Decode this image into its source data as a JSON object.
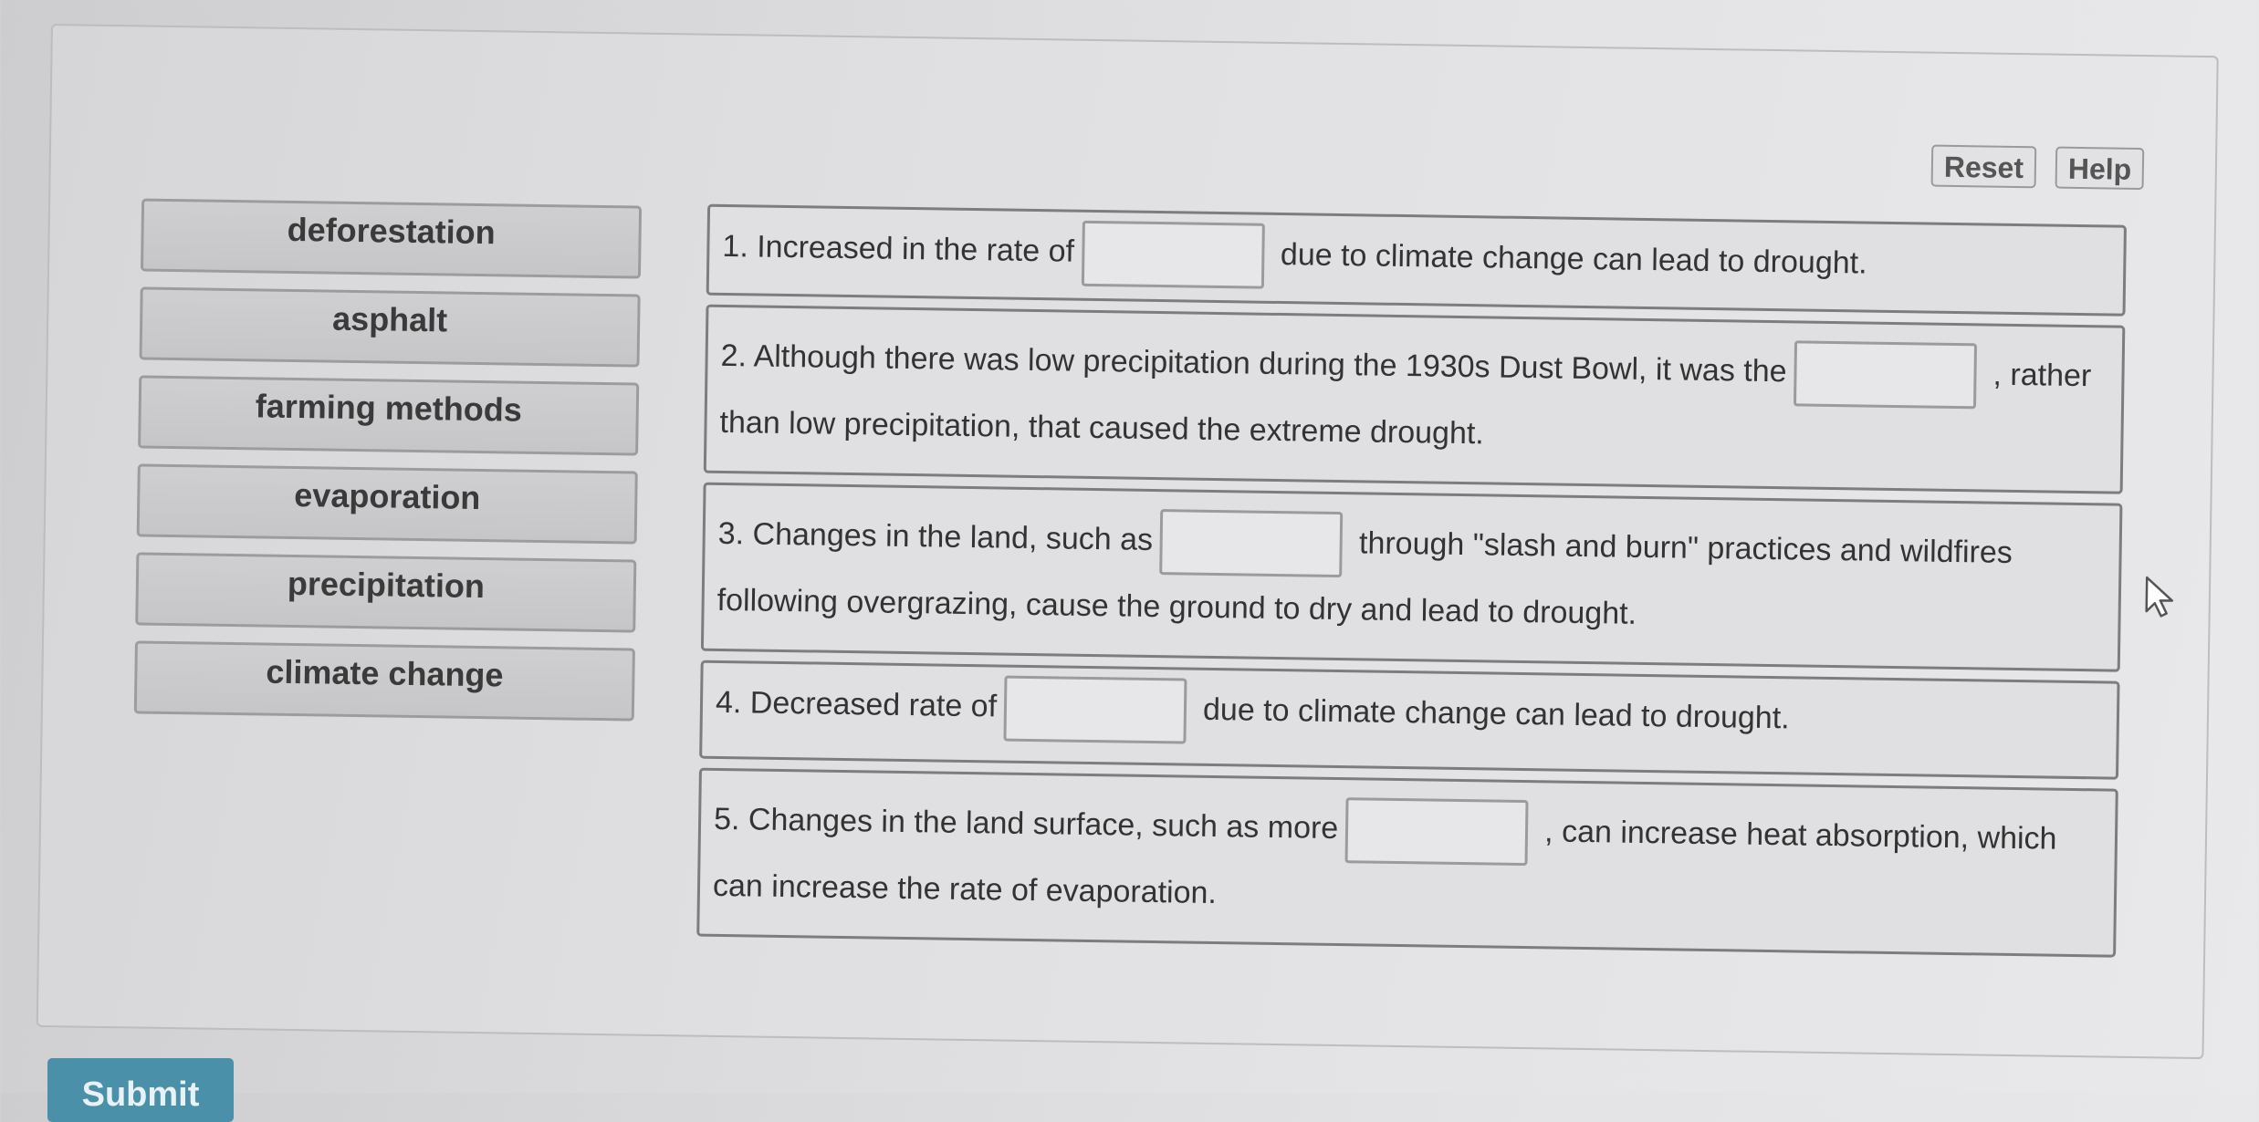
{
  "toolbar": {
    "reset_label": "Reset",
    "help_label": "Help"
  },
  "choices": [
    "deforestation",
    "asphalt",
    "farming methods",
    "evaporation",
    "precipitation",
    "climate change"
  ],
  "statements": [
    {
      "before": "1. Increased in the rate of",
      "after": "due to climate change can lead to drought."
    },
    {
      "before": "2. Although there was low precipitation during the 1930s Dust Bowl, it was the",
      "after": ", rather than low precipitation, that caused the extreme drought."
    },
    {
      "before": "3. Changes in the land, such as",
      "after": "through \"slash and burn\" practices and wildfires following overgrazing, cause the ground to dry and lead to drought."
    },
    {
      "before": "4. Decreased rate of",
      "after": "due to climate change can lead to drought."
    },
    {
      "before": "5. Changes in the land surface, such as more",
      "after": ", can increase heat absorption, which can increase the rate of evaporation."
    }
  ],
  "submit_label": "Submit",
  "icons": {
    "cursor": "mouse-pointer-icon"
  }
}
